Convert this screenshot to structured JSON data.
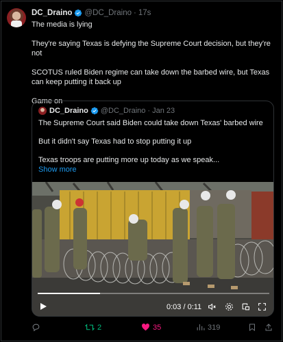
{
  "tweet": {
    "author": "DC_Draino",
    "handle": "@DC_Draino",
    "separator": "·",
    "time": "17s",
    "lines": [
      "The media is lying",
      "They're saying Texas is defying the Supreme Court decision, but they're not",
      "SCOTUS ruled Biden regime can take down the barbed wire, but Texas can keep putting it back up",
      "Game on"
    ]
  },
  "quote": {
    "author": "DC_Draino",
    "handle": "@DC_Draino",
    "separator": "·",
    "date": "Jan 23",
    "lines": [
      "The Supreme Court said Biden could take down Texas' barbed wire",
      "But it didn't say Texas had to stop putting it up",
      "Texas troops are putting more up today as we speak..."
    ],
    "show_more": "Show more",
    "video": {
      "current_time": "0:03",
      "duration": "0:11",
      "time_display": "0:03 / 0:11",
      "progress": 0.27
    }
  },
  "actions": {
    "reposts": "2",
    "likes": "35",
    "views": "319"
  },
  "colors": {
    "accent": "#1d9bf0",
    "repost_active": "#00ba7c",
    "like_active": "#f91880",
    "muted": "#71767b"
  },
  "icons": [
    "verified-icon",
    "play-icon",
    "volume-mute-icon",
    "settings-icon",
    "pip-icon",
    "fullscreen-icon",
    "reply-icon",
    "repost-icon",
    "like-icon",
    "views-icon",
    "bookmark-icon",
    "share-icon"
  ]
}
